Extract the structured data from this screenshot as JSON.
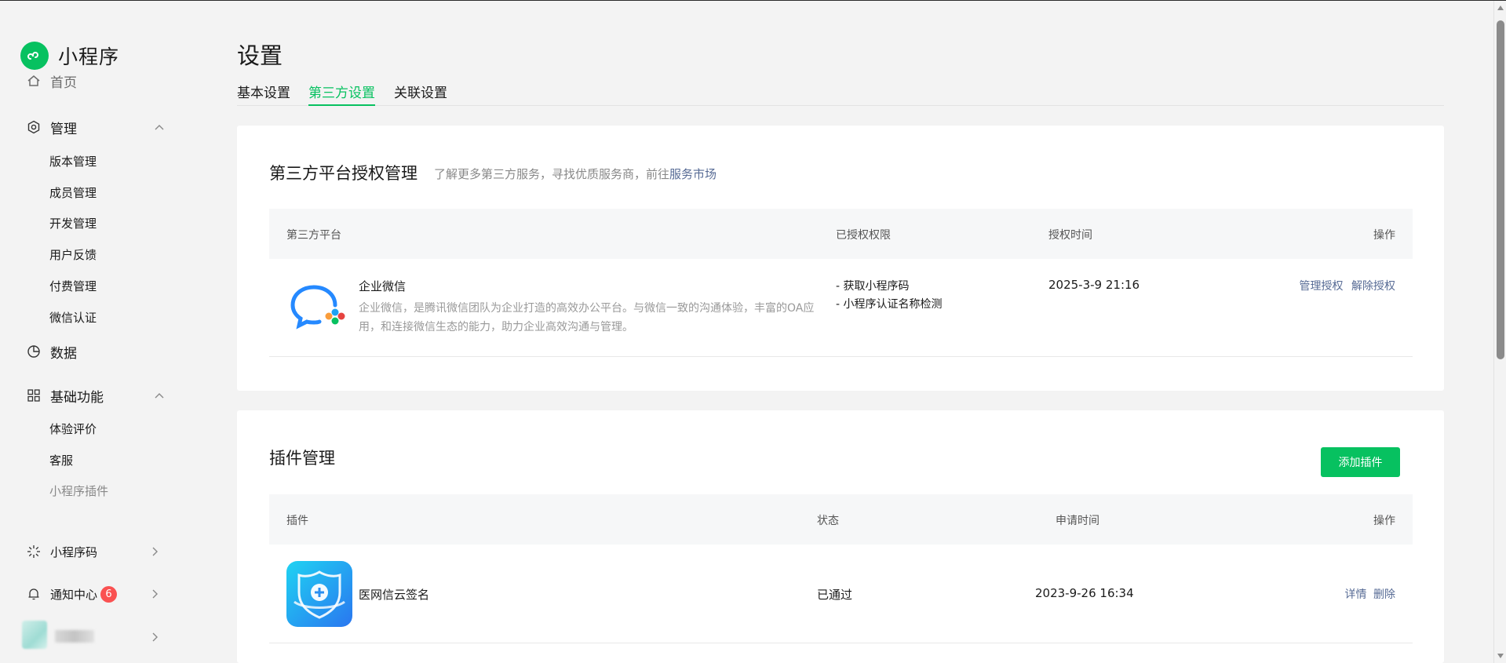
{
  "app": {
    "logo_text": "小程序",
    "logo_icon": "mini-program-logo-icon",
    "accent_color": "#07c160",
    "link_color": "#576b95",
    "badge_color": "#fa5151"
  },
  "sidebar": {
    "partial_item": {
      "label": "首页",
      "icon": "home-icon"
    },
    "groups": [
      {
        "label": "管理",
        "icon": "settings-hex-icon",
        "expanded": true,
        "items": [
          "版本管理",
          "成员管理",
          "开发管理",
          "用户反馈",
          "付费管理",
          "微信认证"
        ]
      },
      {
        "label": "数据",
        "icon": "pie-chart-icon"
      },
      {
        "label": "基础功能",
        "icon": "grid-icon",
        "expanded": true,
        "items": [
          "体验评价",
          "客服",
          "小程序插件"
        ]
      }
    ],
    "bottom": [
      {
        "label": "小程序码",
        "icon": "code-icon"
      },
      {
        "label": "通知中心",
        "icon": "bell-icon",
        "badge": "6"
      }
    ],
    "account": {
      "avatar_icon": "account-avatar-blurred"
    }
  },
  "header": {
    "title": "设置",
    "tabs": [
      "基本设置",
      "第三方设置",
      "关联设置"
    ],
    "active_tab": "第三方设置"
  },
  "third_party": {
    "title": "第三方平台授权管理",
    "desc_prefix": "了解更多第三方服务，寻找优质服务商，前往",
    "desc_link": "服务市场",
    "columns": [
      "第三方平台",
      "已授权权限",
      "授权时间",
      "操作"
    ],
    "rows": [
      {
        "name": "企业微信",
        "icon": "wecom-logo-icon",
        "description": "企业微信，是腾讯微信团队为企业打造的高效办公平台。与微信一致的沟通体验，丰富的OA应用，和连接微信生态的能力，助力企业高效沟通与管理。",
        "permissions": [
          "- 获取小程序码",
          "- 小程序认证名称检测"
        ],
        "time": "2025-3-9 21:16",
        "actions": [
          "管理授权",
          "解除授权"
        ]
      }
    ]
  },
  "plugins": {
    "title": "插件管理",
    "add_button": "添加插件",
    "columns": [
      "插件",
      "状态",
      "申请时间",
      "操作"
    ],
    "rows": [
      {
        "name": "医网信云签名",
        "icon": "medical-shield-app-icon",
        "status": "已通过",
        "time": "2023-9-26 16:34",
        "actions": [
          "详情",
          "删除"
        ]
      }
    ]
  }
}
